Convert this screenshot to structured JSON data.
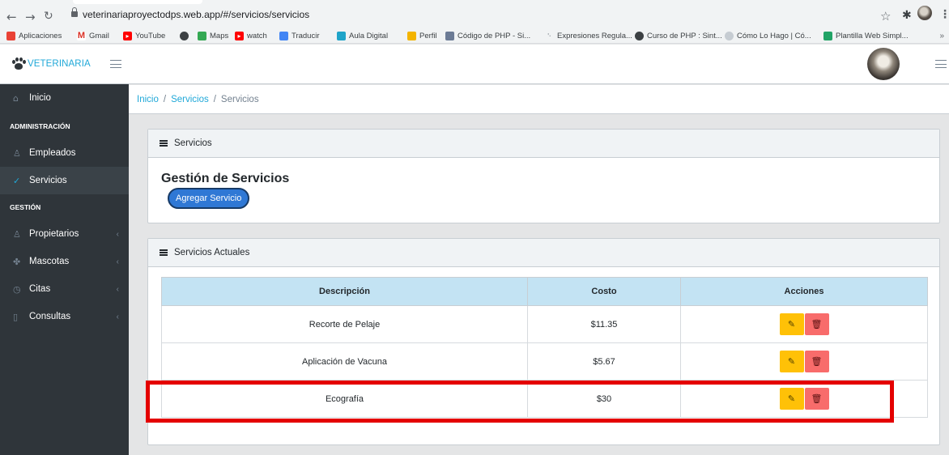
{
  "browser": {
    "url": "veterinariaproyectodps.web.app/#/servicios/servicios",
    "bookmarks": [
      {
        "label": "Aplicaciones",
        "color": "#e94235"
      },
      {
        "label": "Gmail",
        "color": "#d93025"
      },
      {
        "label": "YouTube",
        "color": "#ff0000"
      },
      {
        "label": "",
        "color": "#3c4043"
      },
      {
        "label": "Maps",
        "color": "#34a853"
      },
      {
        "label": "watch",
        "color": "#ff0000"
      },
      {
        "label": "Traducir",
        "color": "#4285f4"
      },
      {
        "label": "Aula Digital",
        "color": "#1fa4c9"
      },
      {
        "label": "Perfil",
        "color": "#f4b400"
      },
      {
        "label": "Código de PHP - Si...",
        "color": "#6c7b95"
      },
      {
        "label": "Expresiones Regula...",
        "color": "#9aa0a6"
      },
      {
        "label": "Curso de PHP : Sint...",
        "color": "#3c4043"
      },
      {
        "label": "Cómo Lo Hago | Có...",
        "color": "#9aa0a6"
      },
      {
        "label": "Plantilla Web Simpl...",
        "color": "#21a366"
      }
    ],
    "more": "»"
  },
  "header": {
    "brand": "VETERINARIA"
  },
  "sidebar": {
    "home": "Inicio",
    "section_admin": "ADMINISTRACIÓN",
    "empleados": "Empleados",
    "servicios": "Servicios",
    "section_gestion": "GESTIÓN",
    "propietarios": "Propietarios",
    "mascotas": "Mascotas",
    "citas": "Citas",
    "consultas": "Consultas"
  },
  "breadcrumb": {
    "home": "Inicio",
    "level1": "Servicios",
    "current": "Servicios"
  },
  "card_top": {
    "header": "Servicios",
    "title": "Gestión de Servicios",
    "add_button": "Agregar Servicio"
  },
  "card_table": {
    "header": "Servicios Actuales",
    "columns": {
      "descripcion": "Descripción",
      "costo": "Costo",
      "acciones": "Acciones"
    },
    "rows": [
      {
        "descripcion": "Recorte de Pelaje",
        "costo": "$11.35"
      },
      {
        "descripcion": "Aplicación de Vacuna",
        "costo": "$5.67"
      },
      {
        "descripcion": "Ecografía",
        "costo": "$30"
      }
    ]
  },
  "colors": {
    "brand": "#20a8d8",
    "sidebar_bg": "#2f353a",
    "primary_button": "#2f78d5",
    "edit_button": "#ffc107",
    "delete_button": "#f86c6b",
    "table_header": "#c3e3f3",
    "highlight": "#e40000"
  }
}
